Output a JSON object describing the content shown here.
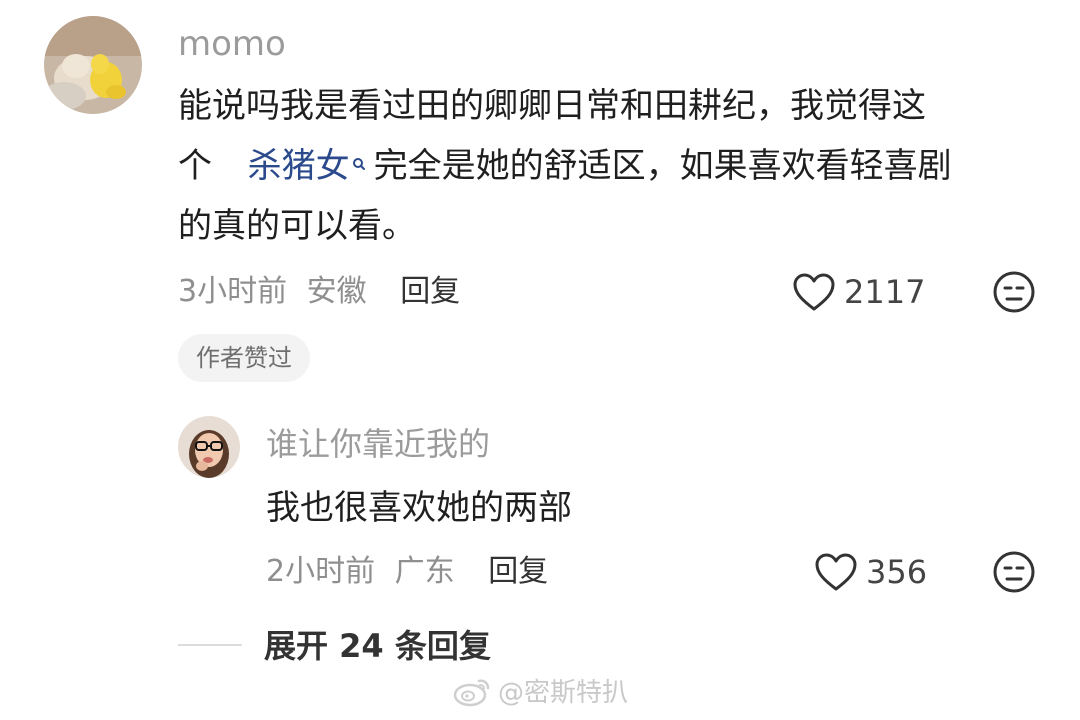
{
  "main_comment": {
    "username": "momo",
    "text_lines": [
      "能说吗我是看过田的卿卿日常和田耕纪，我觉得这",
      "个",
      "完全是她的舒适区，如果喜欢看轻喜剧",
      "的真的可以看。"
    ],
    "keyword_link": "杀猪女",
    "time": "3小时前",
    "location": "安徽",
    "reply_label": "回复",
    "like_count": "2117",
    "author_liked_badge": "作者赞过"
  },
  "reply_comment": {
    "username": "谁让你靠近我的",
    "text": "我也很喜欢她的两部",
    "time": "2小时前",
    "location": "广东",
    "reply_label": "回复",
    "like_count": "356"
  },
  "expand_replies_label": "展开 24 条回复",
  "watermark": "@密斯特扒",
  "icons": {
    "like": "heart-outline-icon",
    "dislike": "meh-face-icon",
    "keyword_search": "search-icon",
    "watermark_logo": "weibo-logo-icon"
  },
  "colors": {
    "keyword_link": "#2b4a8c",
    "username": "#9b9b9b",
    "meta": "#8f8f8f",
    "badge_bg": "#f3f3f3"
  }
}
